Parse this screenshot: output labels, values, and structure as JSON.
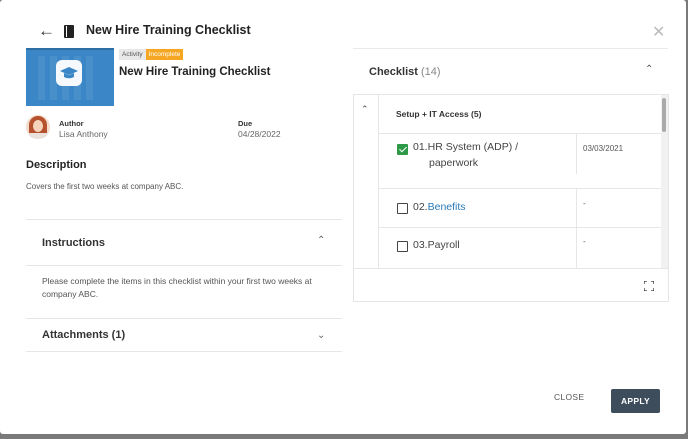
{
  "header": {
    "title": "New Hire Training Checklist"
  },
  "item": {
    "tag_type": "Activity",
    "tag_status": "Incomplete",
    "title": "New Hire Training Checklist",
    "author_label": "Author",
    "author_name": "Lisa Anthony",
    "due_label": "Due",
    "due_date": "04/28/2022"
  },
  "description": {
    "heading": "Description",
    "text": "Covers the first two weeks at company ABC."
  },
  "instructions": {
    "heading": "Instructions",
    "body": "Please complete the items in this checklist within your first two weeks at company ABC."
  },
  "attachments": {
    "heading": "Attachments (1)"
  },
  "checklist": {
    "heading": "Checklist",
    "count": "(14)",
    "group_label": "Setup + IT Access  (5)",
    "items": [
      {
        "num": "01.",
        "text_line1": "HR System (ADP) /",
        "text_line2": "paperwork",
        "date": "03/03/2021",
        "checked": true
      },
      {
        "num": "02.",
        "text_line1": "Benefits",
        "date": "-",
        "checked": false
      },
      {
        "num": "03.",
        "text_line1": "Payroll",
        "date": "-",
        "checked": false
      }
    ]
  },
  "footer": {
    "close_label": "CLOSE",
    "apply_label": "APPLY"
  },
  "colors": {
    "accent": "#3d4d5c",
    "status_incomplete": "#f5a623",
    "checked_green": "#2e9a48",
    "link_blue": "#2a7ab8"
  },
  "icons": [
    "back-arrow-icon",
    "book-icon",
    "close-icon",
    "graduation-cap-icon",
    "chevron-up-icon",
    "chevron-down-icon",
    "expand-icon"
  ]
}
